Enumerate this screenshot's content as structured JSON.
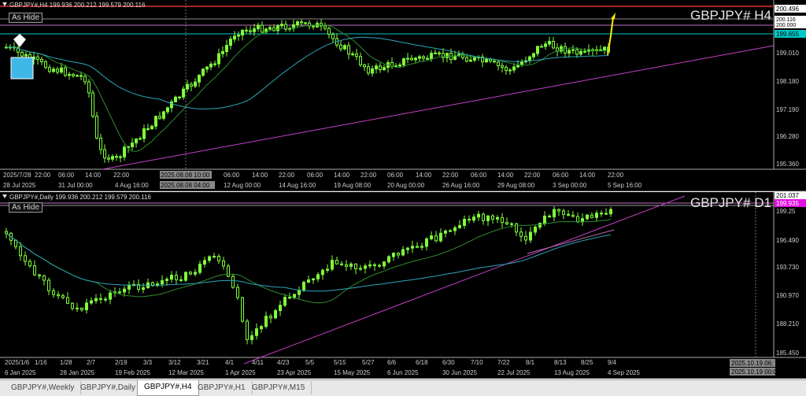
{
  "chart_h4": {
    "header": "GBPJPY#,H4  199.936 200.212 199.579 200.116",
    "as_hide": "As Hide",
    "symbol": "GBPJPY# H4",
    "price_labels": [
      "200.496",
      "200.116",
      "200.000",
      "199.655",
      "199.010",
      "198.180",
      "197.190",
      "196.280",
      "195.360"
    ],
    "time_labels": [
      "28 Jul 2025",
      "31 Jul 00:00",
      "4 Aug 16:00",
      "2025.08.08 04:00",
      "12 Aug 00:00",
      "14 Aug 16:00",
      "19 Aug 08:00",
      "20 Aug 00:00",
      "26 Aug 16:00",
      "29 Aug 08:00",
      "3 Sep 00:00",
      "5 Sep 16:00"
    ],
    "hour_labels": [
      "2025/7/28",
      "22:00",
      "06:00",
      "14:00",
      "22:00",
      "2025.08.08 10:00",
      "06:00",
      "14:00",
      "22:00",
      "06:00",
      "14:00",
      "22:00",
      "06:00",
      "14:00",
      "22:00",
      "06:00",
      "14:00",
      "22:00",
      "06:00",
      "14:00",
      "22:00"
    ]
  },
  "chart_d1": {
    "header": "GBPJPY#,Daily  199.936 200.212 199.579 200.116",
    "as_hide": "As Hide",
    "symbol": "GBPJPY# D1",
    "price_labels": [
      "201.037",
      "199.935",
      "199.25",
      "196.490",
      "193.730",
      "190.970",
      "188.210",
      "185.450"
    ],
    "time_labels": [
      "6 Jan 2025",
      "28 Jan 2025",
      "19 Feb 2025",
      "12 Mar 2025",
      "1 Apr 2025",
      "23 Apr 2025",
      "15 May 2025",
      "6 Jun 2025",
      "30 Jun 2025",
      "22 Jul 2025",
      "13 Aug 2025",
      "4 Sep 2025"
    ],
    "date_labels": [
      "2025/1/6",
      "1/16",
      "1/28",
      "2/7",
      "2/19",
      "3/3",
      "3/12",
      "3/21",
      "4/1",
      "4/11",
      "4/23",
      "5/5",
      "5/15",
      "5/27",
      "6/6",
      "6/18",
      "6/30",
      "7/10",
      "7/22",
      "8/1",
      "8/13",
      "8/25",
      "9/4"
    ],
    "marker_labels": [
      "2025.10.19 06:",
      "2025.10.19 00:00"
    ]
  },
  "tabs": [
    {
      "label": "GBPJPY#,Weekly",
      "active": false
    },
    {
      "label": "GBPJPY#,Daily",
      "active": false
    },
    {
      "label": "GBPJPY#,H4",
      "active": true
    },
    {
      "label": "GBPJPY#,H1",
      "active": false
    },
    {
      "label": "GBPJPY#,M15",
      "active": false
    }
  ],
  "colors": {
    "bg": "#000000",
    "candle": "#7fff3a",
    "ma_fast": "#2e8b2e",
    "ma_slow": "#2aa6b8",
    "trend": "#c63fc6",
    "price_line": "#00c8c8",
    "resistance": "#e03030",
    "accent_box": "#3fb8e8",
    "arrow": "#ffee00"
  }
}
